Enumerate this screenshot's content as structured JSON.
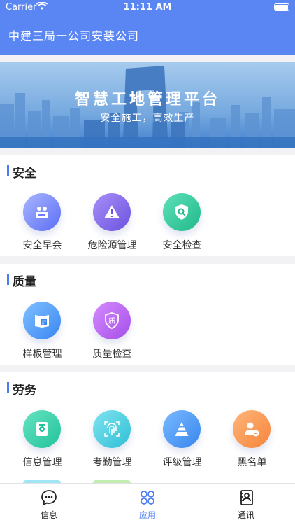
{
  "status_bar": {
    "carrier": "Carrier",
    "time": "11:11 AM"
  },
  "header": {
    "title": "中建三局一公司安装公司"
  },
  "banner": {
    "title": "智慧工地管理平台",
    "subtitle": "安全施工，高效生产"
  },
  "sections": [
    {
      "title": "安全",
      "items": [
        {
          "label": "安全早会",
          "icon": "meeting-icon",
          "color_from": "#a9b6ff",
          "color_to": "#5b6ef5"
        },
        {
          "label": "危险源管理",
          "icon": "warning-icon",
          "color_from": "#a98ff7",
          "color_to": "#6b52e0"
        },
        {
          "label": "安全检查",
          "icon": "shield-search-icon",
          "color_from": "#5fe0b8",
          "color_to": "#1fb98a"
        }
      ]
    },
    {
      "title": "质量",
      "items": [
        {
          "label": "样板管理",
          "icon": "template-icon",
          "color_from": "#7fc0ff",
          "color_to": "#3a86f2"
        },
        {
          "label": "质量检查",
          "icon": "quality-shield-icon",
          "color_from": "#d58cff",
          "color_to": "#a54ee8"
        }
      ]
    },
    {
      "title": "劳务",
      "items": [
        {
          "label": "信息管理",
          "icon": "info-doc-icon",
          "color_from": "#66e3c2",
          "color_to": "#21c39a"
        },
        {
          "label": "考勤管理",
          "icon": "fingerprint-icon",
          "color_from": "#80e4f0",
          "color_to": "#30bfd6"
        },
        {
          "label": "评级管理",
          "icon": "pyramid-icon",
          "color_from": "#7ab9ff",
          "color_to": "#3786ee"
        },
        {
          "label": "黑名单",
          "icon": "user-block-icon",
          "color_from": "#ffb67a",
          "color_to": "#f5843b"
        }
      ]
    }
  ],
  "tab_bar": [
    {
      "label": "信息",
      "icon": "chat-icon",
      "active": false
    },
    {
      "label": "应用",
      "icon": "apps-icon",
      "active": true
    },
    {
      "label": "通讯",
      "icon": "contacts-icon",
      "active": false
    }
  ],
  "colors": {
    "primary": "#5a86f4",
    "accent": "#4c7cf3",
    "section_bar": "#4c7cf3"
  }
}
